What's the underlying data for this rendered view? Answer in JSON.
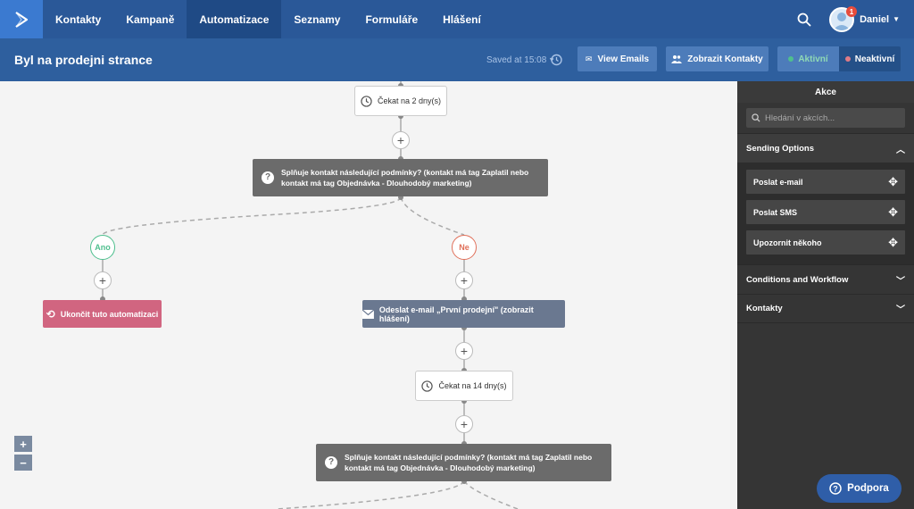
{
  "nav": {
    "items": [
      {
        "label": "Kontakty"
      },
      {
        "label": "Kampaně"
      },
      {
        "label": "Automatizace"
      },
      {
        "label": "Seznamy"
      },
      {
        "label": "Formuláře"
      },
      {
        "label": "Hlášení"
      }
    ],
    "active_index": 2,
    "user_name": "Daniel",
    "notification_count": "1"
  },
  "header": {
    "title": "Byl na prodejni strance",
    "saved": "Saved at 15:08",
    "view_emails": "View Emails",
    "show_contacts": "Zobrazit Kontakty",
    "active": "Aktivní",
    "inactive": "Neaktivní"
  },
  "flow": {
    "wait1": "Čekat na 2 dny(s)",
    "cond1_line1": "Splňuje kontakt následující podmínky? (kontakt má tag Zaplatil nebo",
    "cond1_line2": "kontakt má tag Objednávka - Dlouhodobý marketing)",
    "yes": "Ano",
    "no": "Ne",
    "end": "Ukončit tuto automatizaci",
    "send_email": "Odeslat e-mail „První prodejní\" (zobrazit hlášení)",
    "wait2": "Čekat na 14 dny(s)",
    "cond2_line1": "Splňuje kontakt následující podmínky? (kontakt má tag Zaplatil nebo",
    "cond2_line2": "kontakt má tag Objednávka - Dlouhodobý marketing)"
  },
  "panel": {
    "title": "Akce",
    "search_placeholder": "Hledání v akcích...",
    "sections": [
      {
        "label": "Sending Options",
        "open": true,
        "actions": [
          "Poslat e-mail",
          "Poslat SMS",
          "Upozornit někoho"
        ]
      },
      {
        "label": "Conditions and Workflow",
        "open": false
      },
      {
        "label": "Kontakty",
        "open": false
      }
    ]
  },
  "support": "Podpora",
  "colors": {
    "nav": "#2a5898",
    "yes": "#4fbf8e",
    "no": "#e0705a",
    "end_node": "#d16580",
    "email_node": "#6a7890"
  }
}
